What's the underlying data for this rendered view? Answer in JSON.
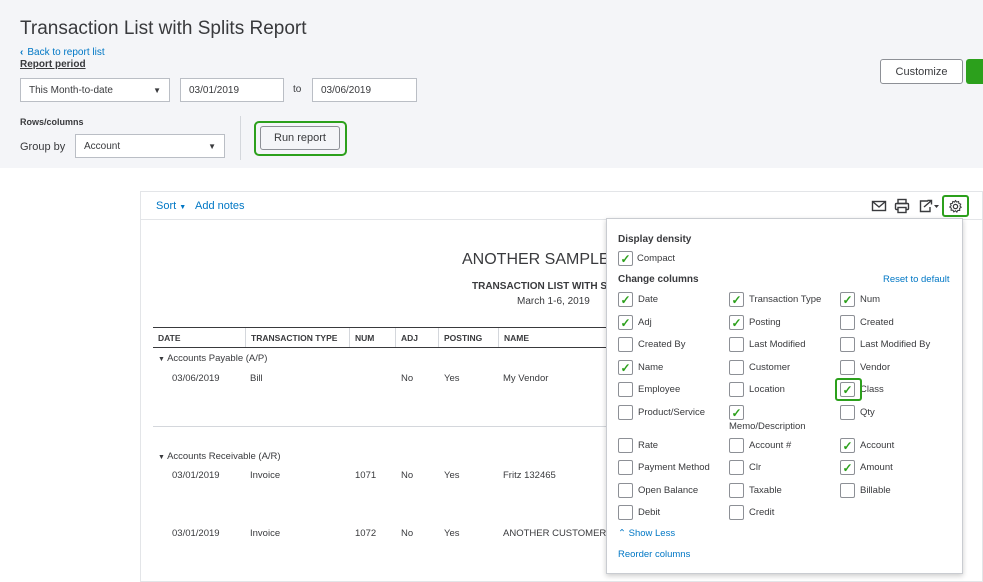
{
  "header": {
    "title": "Transaction List with Splits Report",
    "back_link": "Back to report list",
    "period_label": "Report period",
    "period_select": "This Month-to-date",
    "date_from": "03/01/2019",
    "to_label": "to",
    "date_to": "03/06/2019",
    "rows_columns_label": "Rows/columns",
    "group_by_label": "Group by",
    "group_by_value": "Account",
    "run_report": "Run report",
    "customize": "Customize"
  },
  "toolbar": {
    "sort": "Sort",
    "add_notes": "Add notes"
  },
  "report": {
    "company": "ANOTHER SAMPLE",
    "title": "TRANSACTION LIST WITH S",
    "dates": "March 1-6, 2019",
    "columns": [
      "DATE",
      "TRANSACTION TYPE",
      "NUM",
      "ADJ",
      "POSTING",
      "NAME"
    ],
    "groups": [
      {
        "label": "Accounts Payable (A/P)",
        "rows": [
          {
            "date": "03/06/2019",
            "type": "Bill",
            "num": "",
            "adj": "No",
            "posting": "Yes",
            "name": "My Vendor"
          }
        ]
      },
      {
        "label": "Accounts Receivable (A/R)",
        "rows": [
          {
            "date": "03/01/2019",
            "type": "Invoice",
            "num": "1071",
            "adj": "No",
            "posting": "Yes",
            "name": "Fritz 132465"
          },
          {
            "date": "03/01/2019",
            "type": "Invoice",
            "num": "1072",
            "adj": "No",
            "posting": "Yes",
            "name": "ANOTHER CUSTOMER:"
          }
        ]
      }
    ]
  },
  "panel": {
    "display_density": "Display density",
    "compact": {
      "label": "Compact",
      "checked": true
    },
    "change_columns": "Change columns",
    "reset": "Reset to default",
    "columns": [
      {
        "label": "Date",
        "checked": true
      },
      {
        "label": "Transaction Type",
        "checked": true
      },
      {
        "label": "Num",
        "checked": true
      },
      {
        "label": "Adj",
        "checked": true
      },
      {
        "label": "Posting",
        "checked": true
      },
      {
        "label": "Created",
        "checked": false
      },
      {
        "label": "Created By",
        "checked": false
      },
      {
        "label": "Last Modified",
        "checked": false
      },
      {
        "label": "Last Modified By",
        "checked": false
      },
      {
        "label": "Name",
        "checked": true
      },
      {
        "label": "Customer",
        "checked": false
      },
      {
        "label": "Vendor",
        "checked": false
      },
      {
        "label": "Employee",
        "checked": false
      },
      {
        "label": "Location",
        "checked": false
      },
      {
        "label": "Class",
        "checked": true
      },
      {
        "label": "Product/Service",
        "checked": false
      },
      {
        "label": "Memo/Description",
        "checked": true
      },
      {
        "label": "Qty",
        "checked": false
      },
      {
        "label": "Rate",
        "checked": false
      },
      {
        "label": "Account #",
        "checked": false
      },
      {
        "label": "Account",
        "checked": true
      },
      {
        "label": "Payment Method",
        "checked": false
      },
      {
        "label": "Clr",
        "checked": false
      },
      {
        "label": "Amount",
        "checked": true
      },
      {
        "label": "Open Balance",
        "checked": false
      },
      {
        "label": "Taxable",
        "checked": false
      },
      {
        "label": "Billable",
        "checked": false
      },
      {
        "label": "Debit",
        "checked": false
      },
      {
        "label": "Credit",
        "checked": false
      }
    ],
    "show_less": "Show Less",
    "reorder": "Reorder columns"
  },
  "icons": {
    "back": "chevron-left-icon",
    "caret": "caret-down-icon",
    "email": "email-icon",
    "print": "print-icon",
    "export": "export-icon",
    "settings": "gear-icon"
  },
  "colors": {
    "accent": "#2ca01c",
    "link": "#0077c5",
    "text": "#393a3d"
  }
}
